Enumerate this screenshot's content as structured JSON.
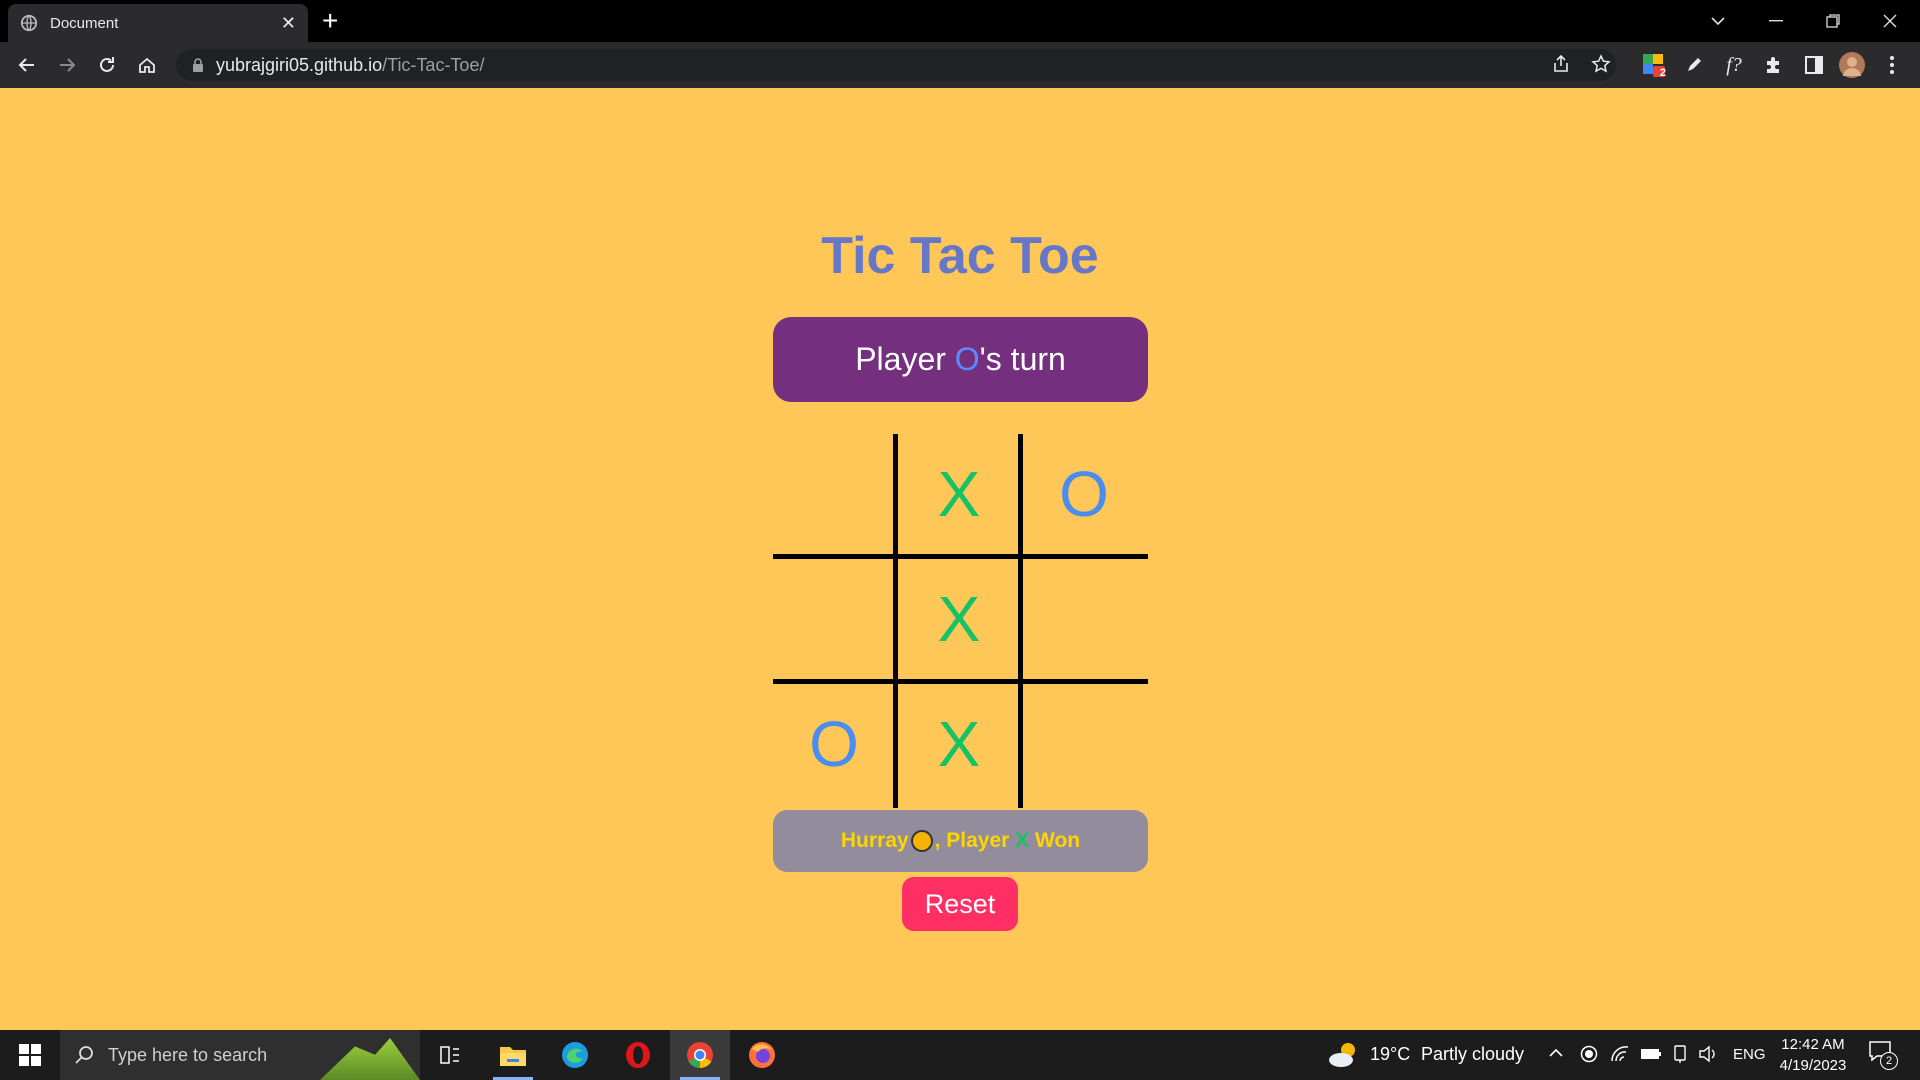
{
  "browser": {
    "tab_title": "Document",
    "url_host": "yubrajgiri05.github.io",
    "url_path": "/Tic-Tac-Toe/",
    "extension_badge": "2"
  },
  "game": {
    "title": "Tic Tac Toe",
    "turn_prefix": "Player ",
    "turn_symbol": "O",
    "turn_suffix": "'s turn",
    "cells": [
      "",
      "X",
      "O",
      "",
      "X",
      "",
      "O",
      "X",
      ""
    ],
    "winner_prefix": "Hurray",
    "winner_mid": ", Player ",
    "winner_symbol": "X",
    "winner_suffix": " Won",
    "reset_label": "Reset"
  },
  "colors": {
    "background": "#ffc757",
    "title": "#6677c8",
    "turn_box": "#74307f",
    "x": "#17c267",
    "o": "#4a8df0",
    "reset": "#ff2e63",
    "winner_box": "#928c9c"
  },
  "taskbar": {
    "search_placeholder": "Type here to search",
    "weather_temp": "19°C",
    "weather_text": "Partly cloudy",
    "language": "ENG",
    "time": "12:42 AM",
    "date": "4/19/2023",
    "notification_count": "2"
  }
}
